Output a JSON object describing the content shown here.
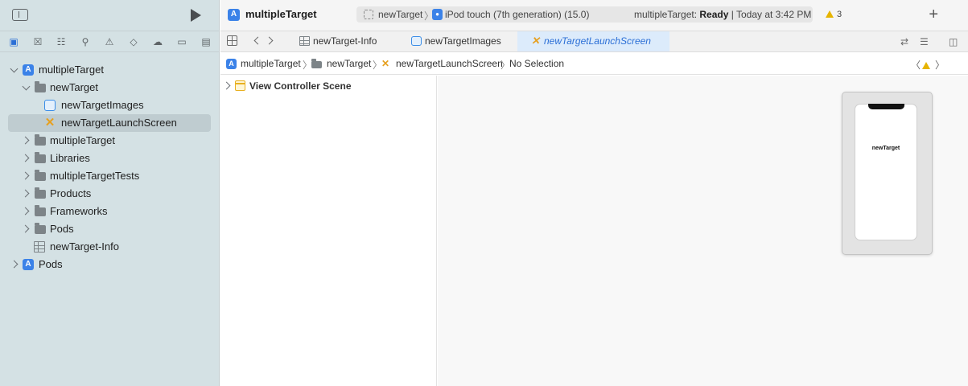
{
  "project": {
    "title": "multipleTarget"
  },
  "scheme": {
    "target": "newTarget",
    "device": "iPod touch (7th generation) (15.0)",
    "status_prefix": "multipleTarget: ",
    "status_state": "Ready",
    "status_time": " | Today at 3:42 PM",
    "warnings": "3"
  },
  "navigator_tabs": [
    "folder-icon",
    "source-control-icon",
    "symbol-icon",
    "find-icon",
    "issue-icon",
    "test-icon",
    "debug-icon",
    "breakpoint-icon",
    "report-icon"
  ],
  "tree": [
    {
      "label": "multipleTarget",
      "icon": "app-project-icon",
      "level": 0,
      "expanded": true
    },
    {
      "label": "newTarget",
      "icon": "folder-icon",
      "level": 1,
      "expanded": true
    },
    {
      "label": "newTargetImages",
      "icon": "asset-catalog-icon",
      "level": 2
    },
    {
      "label": "newTargetLaunchScreen",
      "icon": "storyboard-icon",
      "level": 2,
      "selected": true
    },
    {
      "label": "multipleTarget",
      "icon": "folder-icon",
      "level": 1,
      "expanded": false
    },
    {
      "label": "Libraries",
      "icon": "folder-icon",
      "level": 1,
      "expanded": false
    },
    {
      "label": "multipleTargetTests",
      "icon": "folder-icon",
      "level": 1,
      "expanded": false
    },
    {
      "label": "Products",
      "icon": "folder-icon",
      "level": 1,
      "expanded": false
    },
    {
      "label": "Frameworks",
      "icon": "folder-icon",
      "level": 1,
      "expanded": false
    },
    {
      "label": "Pods",
      "icon": "folder-icon",
      "level": 1,
      "expanded": false
    },
    {
      "label": "newTarget-Info",
      "icon": "plist-icon",
      "level": 1
    },
    {
      "label": "Pods",
      "icon": "app-project-icon",
      "level": 0,
      "expanded": false
    }
  ],
  "editor_tabs": [
    {
      "label": "newTarget-Info",
      "icon": "plist-icon"
    },
    {
      "label": "newTargetImages",
      "icon": "asset-catalog-icon"
    },
    {
      "label": "newTargetLaunchScreen",
      "icon": "storyboard-icon",
      "active": true
    }
  ],
  "breadcrumb": [
    "multipleTarget",
    "newTarget",
    "newTargetLaunchScreen",
    "No Selection"
  ],
  "outline": {
    "scene": "View Controller Scene"
  },
  "canvas": {
    "screen_label": "newTarget"
  },
  "colors": {
    "sidebar_bg": "#d4e1e4",
    "accent": "#2b6fd6",
    "storyboard_icon": "#e6a020",
    "warning": "#e6b400"
  }
}
